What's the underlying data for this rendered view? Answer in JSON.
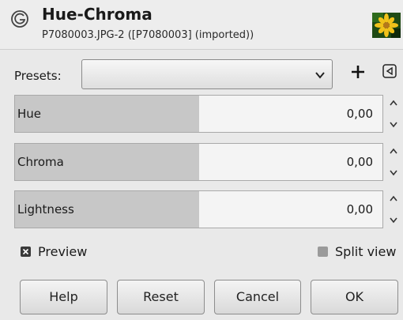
{
  "dialog": {
    "title": "Hue-Chroma",
    "subtitle": "P7080003.JPG-2 ([P7080003] (imported))",
    "icon": "gimp-wilber-icon",
    "thumbnail": "image-thumbnail"
  },
  "presets": {
    "label": "Presets:",
    "value": "",
    "add_icon": "plus-icon",
    "menu_icon": "triangle-left-icon"
  },
  "sliders": [
    {
      "label": "Hue",
      "value": "0,00",
      "fill": 0.5
    },
    {
      "label": "Chroma",
      "value": "0,00",
      "fill": 0.5
    },
    {
      "label": "Lightness",
      "value": "0,00",
      "fill": 0.5
    }
  ],
  "options": {
    "preview_label": "Preview",
    "preview_checked": true,
    "split_view_label": "Split view",
    "split_view_checked": false
  },
  "buttons": {
    "help": "Help",
    "reset": "Reset",
    "cancel": "Cancel",
    "ok": "OK"
  }
}
